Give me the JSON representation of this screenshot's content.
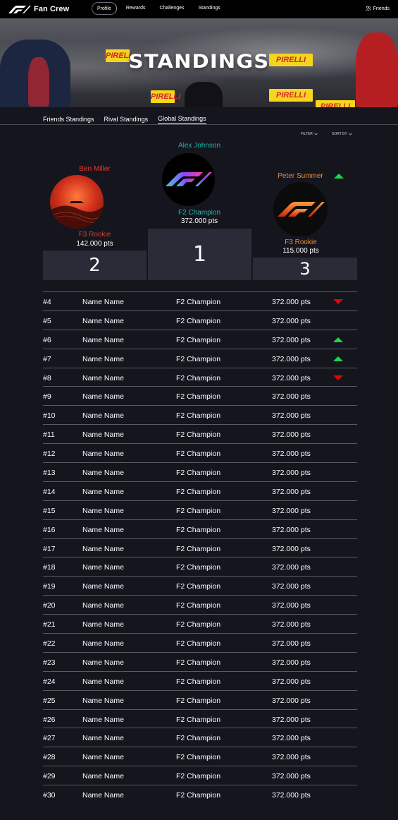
{
  "app": {
    "title": "Fan Crew"
  },
  "nav": {
    "links": [
      "Profile",
      "Rewards",
      "Challenges",
      "Standings"
    ],
    "active": "Profile",
    "friends_label": "Friends"
  },
  "hero": {
    "title": "STANDINGS",
    "sign_text": "PIRELLI"
  },
  "tabs": {
    "items": [
      "Friends Standings",
      "Rival Standings",
      "Global Standings"
    ],
    "active": "Global Standings"
  },
  "filters": {
    "filter_label": "FILTER",
    "sort_label": "SORT BY"
  },
  "podium": {
    "first": {
      "name": "Alex Johnson",
      "tier": "F2 Champion",
      "pts": "372.000 pts",
      "rank": "1",
      "name_color": "#1fb5ac",
      "tier_color": "#1fb5ac"
    },
    "second": {
      "name": "Ben Miller",
      "tier": "F3 Rookie",
      "pts": "142.000 pts",
      "rank": "2",
      "name_color": "#e33b2f",
      "tier_color": "#e33b2f"
    },
    "third": {
      "name": "Peter Summer",
      "tier": "F3 Rookie",
      "pts": "115.000 pts",
      "rank": "3",
      "name_color": "#f08a24",
      "tier_color": "#f08a24",
      "trend": "up"
    }
  },
  "colors": {
    "up": "#1fd54c",
    "down": "#e10600",
    "background": "#15151e",
    "block": "#2b2b37"
  },
  "table": {
    "rows": [
      {
        "rank": "#4",
        "name": "Name Name",
        "tier": "F2 Champion",
        "pts": "372.000 pts",
        "trend": "down"
      },
      {
        "rank": "#5",
        "name": "Name Name",
        "tier": "F2 Champion",
        "pts": "372.000 pts",
        "trend": ""
      },
      {
        "rank": "#6",
        "name": "Name Name",
        "tier": "F2 Champion",
        "pts": "372.000 pts",
        "trend": "up"
      },
      {
        "rank": "#7",
        "name": "Name Name",
        "tier": "F2 Champion",
        "pts": "372.000 pts",
        "trend": "up"
      },
      {
        "rank": "#8",
        "name": "Name Name",
        "tier": "F2 Champion",
        "pts": "372.000 pts",
        "trend": "down"
      },
      {
        "rank": "#9",
        "name": "Name Name",
        "tier": "F2 Champion",
        "pts": "372.000 pts",
        "trend": ""
      },
      {
        "rank": "#10",
        "name": "Name Name",
        "tier": "F2 Champion",
        "pts": "372.000 pts",
        "trend": ""
      },
      {
        "rank": "#11",
        "name": "Name Name",
        "tier": "F2 Champion",
        "pts": "372.000 pts",
        "trend": ""
      },
      {
        "rank": "#12",
        "name": "Name Name",
        "tier": "F2 Champion",
        "pts": "372.000 pts",
        "trend": ""
      },
      {
        "rank": "#13",
        "name": "Name Name",
        "tier": "F2 Champion",
        "pts": "372.000 pts",
        "trend": ""
      },
      {
        "rank": "#14",
        "name": "Name Name",
        "tier": "F2 Champion",
        "pts": "372.000 pts",
        "trend": ""
      },
      {
        "rank": "#15",
        "name": "Name Name",
        "tier": "F2 Champion",
        "pts": "372.000 pts",
        "trend": ""
      },
      {
        "rank": "#16",
        "name": "Name Name",
        "tier": "F2 Champion",
        "pts": "372.000 pts",
        "trend": ""
      },
      {
        "rank": "#17",
        "name": "Name Name",
        "tier": "F2 Champion",
        "pts": "372.000 pts",
        "trend": ""
      },
      {
        "rank": "#18",
        "name": "Name Name",
        "tier": "F2 Champion",
        "pts": "372.000 pts",
        "trend": ""
      },
      {
        "rank": "#19",
        "name": "Name Name",
        "tier": "F2 Champion",
        "pts": "372.000 pts",
        "trend": ""
      },
      {
        "rank": "#20",
        "name": "Name Name",
        "tier": "F2 Champion",
        "pts": "372.000 pts",
        "trend": ""
      },
      {
        "rank": "#21",
        "name": "Name Name",
        "tier": "F2 Champion",
        "pts": "372.000 pts",
        "trend": ""
      },
      {
        "rank": "#22",
        "name": "Name Name",
        "tier": "F2 Champion",
        "pts": "372.000 pts",
        "trend": ""
      },
      {
        "rank": "#23",
        "name": "Name Name",
        "tier": "F2 Champion",
        "pts": "372.000 pts",
        "trend": ""
      },
      {
        "rank": "#24",
        "name": "Name Name",
        "tier": "F2 Champion",
        "pts": "372.000 pts",
        "trend": ""
      },
      {
        "rank": "#25",
        "name": "Name Name",
        "tier": "F2 Champion",
        "pts": "372.000 pts",
        "trend": ""
      },
      {
        "rank": "#26",
        "name": "Name Name",
        "tier": "F2 Champion",
        "pts": "372.000 pts",
        "trend": ""
      },
      {
        "rank": "#27",
        "name": "Name Name",
        "tier": "F2 Champion",
        "pts": "372.000 pts",
        "trend": ""
      },
      {
        "rank": "#28",
        "name": "Name Name",
        "tier": "F2 Champion",
        "pts": "372.000 pts",
        "trend": ""
      },
      {
        "rank": "#29",
        "name": "Name Name",
        "tier": "F2 Champion",
        "pts": "372.000 pts",
        "trend": ""
      },
      {
        "rank": "#30",
        "name": "Name Name",
        "tier": "F2 Champion",
        "pts": "372.000 pts",
        "trend": ""
      }
    ]
  }
}
